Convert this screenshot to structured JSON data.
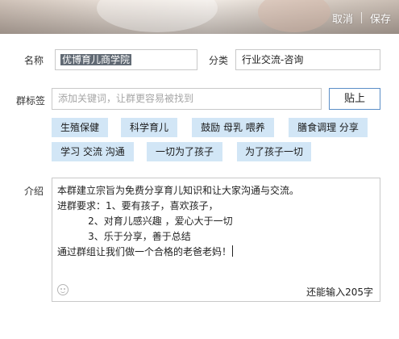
{
  "header": {
    "cancel_label": "取消",
    "save_label": "保存"
  },
  "form": {
    "name_label": "名称",
    "name_value": "优博育儿商学院",
    "category_label": "分类",
    "category_value": "行业交流-咨询",
    "tags_label": "群标签",
    "tag_input_placeholder": "添加关键词，让群更容易被找到",
    "post_button_label": "贴上",
    "suggested_tags": [
      "生殖保健",
      "科学育儿",
      "鼓励 母乳 喂养",
      "膳食调理 分享",
      "学习 交流 沟通",
      "一切为了孩子",
      "为了孩子一切"
    ],
    "intro_label": "介绍",
    "intro_lines": [
      "本群建立宗旨为免费分享育儿知识和让大家沟通与交流。",
      "进群要求：1、要有孩子，喜欢孩子，",
      "          2、对育儿感兴趣 ，爱心大于一切",
      "          3、乐于分享，善于总结",
      "通过群组让我们做一个合格的老爸老妈！"
    ],
    "remaining_chars": "还能输入205字"
  },
  "colors": {
    "tag_bg": "#d2e6f6",
    "button_border": "#5b8ec7",
    "selection_bg": "#616a74"
  },
  "icons": {
    "emoji": "emoji-icon"
  }
}
